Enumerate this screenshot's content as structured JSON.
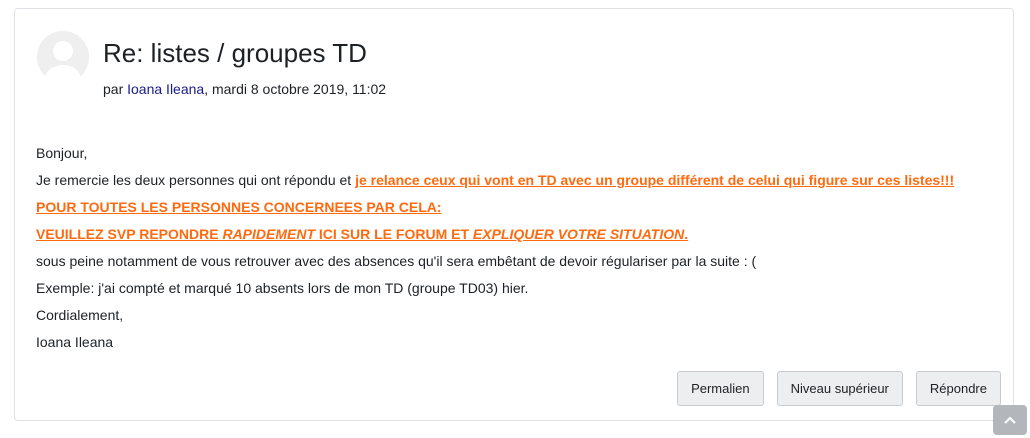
{
  "post": {
    "title": "Re: listes / groupes TD",
    "byline_prefix": "par ",
    "author": "Ioana Ileana",
    "date": ", mardi 8 octobre 2019, 11:02",
    "body": {
      "line1": "Bonjour,",
      "line2_plain": "Je remercie les deux personnes qui ont répondu et ",
      "line2_highlight": "je relance ceux qui vont en TD avec un groupe différent de celui qui figure sur ces listes!!!",
      "line3": "POUR TOUTES LES PERSONNES CONCERNEES PAR CELA:",
      "line4_a": "VEUILLEZ SVP REPONDRE ",
      "line4_b": "RAPIDEMENT",
      "line4_c": " ICI SUR LE FORUM ET ",
      "line4_d": "EXPLIQUER VOTRE SITUATION",
      "line4_e": ".",
      "line5": "sous peine notamment de vous retrouver avec des absences qu'il sera embêtant de devoir régulariser par la suite : (",
      "line6": "Exemple: j'ai compté et marqué 10 absents lors de mon TD (groupe TD03) hier.",
      "line7": "Cordialement,",
      "line8": "Ioana Ileana"
    },
    "actions": {
      "permalink": "Permalien",
      "parent": "Niveau supérieur",
      "reply": "Répondre"
    }
  },
  "colors": {
    "highlight": "#ff6a0f",
    "author_link": "#1a1a8c"
  },
  "icons": {
    "avatar": "user-avatar-icon",
    "scroll_top": "chevron-up-icon"
  }
}
